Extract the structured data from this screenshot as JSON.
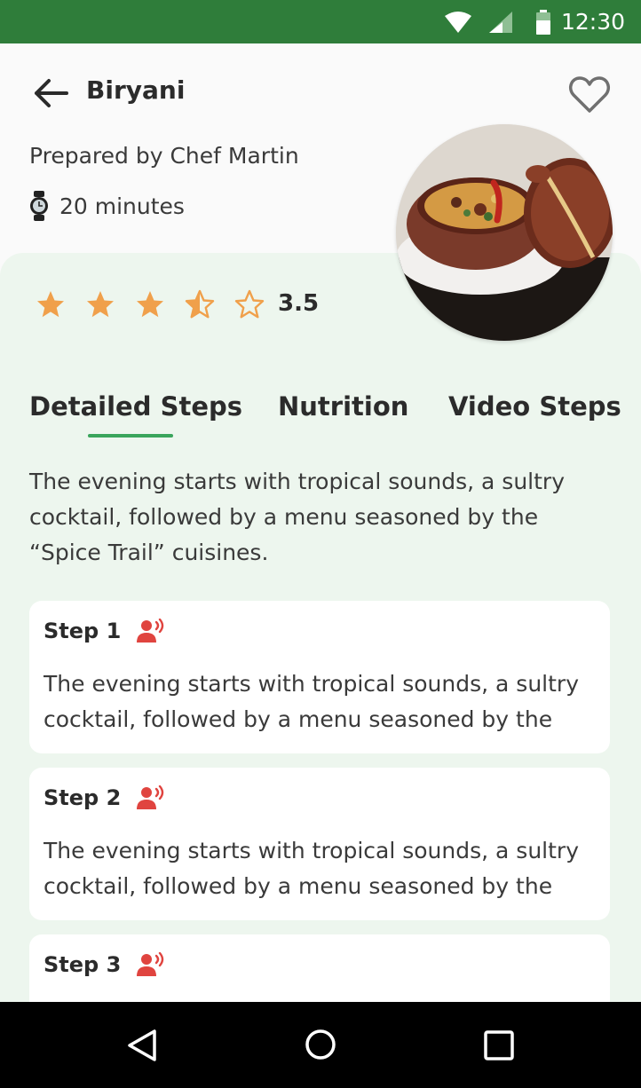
{
  "status_bar": {
    "time": "12:30"
  },
  "header": {
    "title": "Biryani",
    "chef": "Prepared by Chef Martin",
    "duration": "20 minutes"
  },
  "rating": {
    "value": 3.5,
    "label": "3.5"
  },
  "tabs": [
    {
      "label": "Detailed Steps",
      "active": true
    },
    {
      "label": "Nutrition",
      "active": false
    },
    {
      "label": "Video Steps",
      "active": false
    }
  ],
  "intro": "The evening starts with tropical sounds, a sultry cocktail, followed by a menu seasoned by the “Spice Trail” cuisines.",
  "steps": [
    {
      "label": "Step 1",
      "text": "The evening starts with tropical sounds, a sultry cocktail, followed by a menu seasoned by the"
    },
    {
      "label": "Step 2",
      "text": "The evening starts with tropical sounds, a sultry cocktail, followed by a menu seasoned by the"
    },
    {
      "label": "Step 3",
      "text": ""
    }
  ],
  "colors": {
    "status_bar": "#2f7d3a",
    "accent": "#3aa55c",
    "star": "#f0a04b",
    "speaker": "#e0443f",
    "sheet": "#edf6ee"
  },
  "icons": [
    "wifi-icon",
    "signal-icon",
    "battery-icon",
    "back-arrow-icon",
    "heart-icon",
    "watch-icon",
    "star-icon",
    "speaker-icon",
    "nav-back-icon",
    "nav-home-icon",
    "nav-recent-icon"
  ]
}
